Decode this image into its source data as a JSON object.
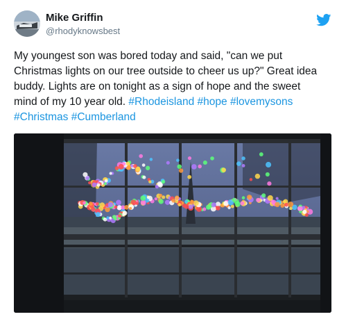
{
  "tweet": {
    "author_name": "Mike Griffin",
    "author_handle": "@rhodyknowsbest",
    "body_lines": [
      "My youngest son was bored today and said, \"can we put",
      "Christmas lights on our tree outside to cheer us up?\"  Great idea",
      "buddy. Lights are on tonight as a sign of hope and the sweet",
      "mind of my 10 year old."
    ],
    "hashtags": [
      "#Rhodeisland",
      "#hope",
      "#lovemysons",
      "#Christmas",
      "#Cumberland"
    ]
  },
  "icons": {
    "brand": "twitter-bird-icon"
  },
  "colors": {
    "link": "#1b95e0",
    "twitter_blue": "#1da1f2",
    "text": "#14171a",
    "muted": "#657786"
  }
}
